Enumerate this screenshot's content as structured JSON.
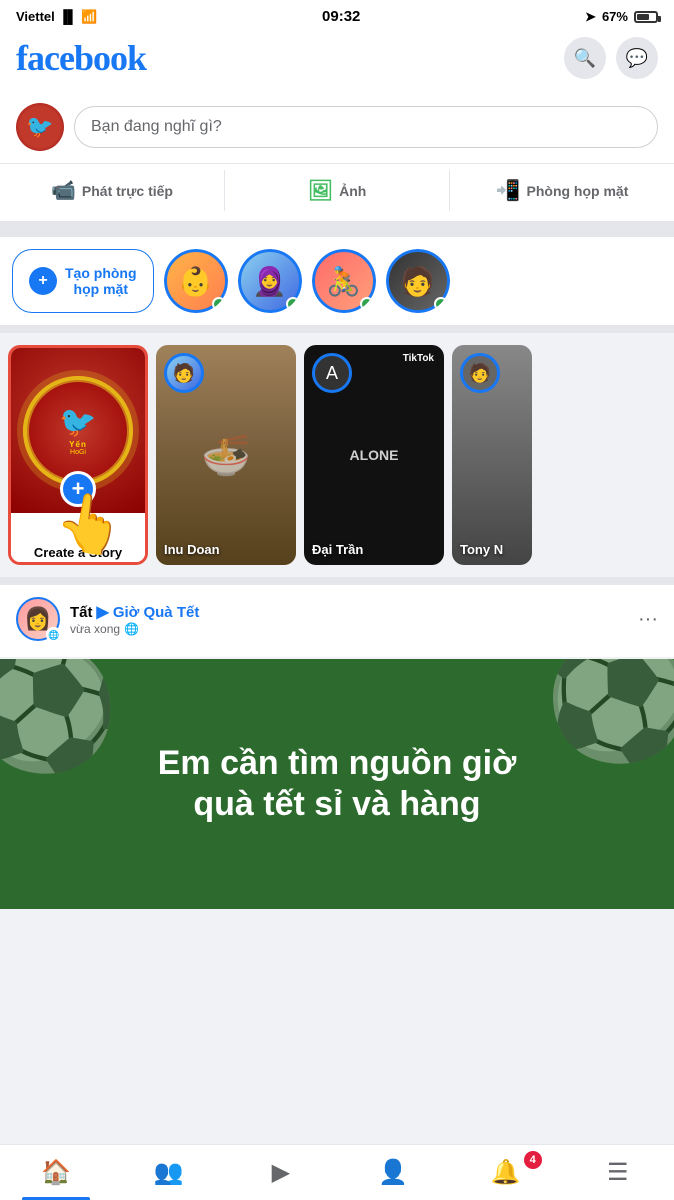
{
  "statusBar": {
    "carrier": "Viettel",
    "time": "09:32",
    "battery": "67%"
  },
  "header": {
    "logo": "facebook",
    "searchIcon": "🔍",
    "messengerIcon": "💬"
  },
  "postBar": {
    "placeholder": "Bạn đang nghĩ gì?"
  },
  "actionButtons": [
    {
      "id": "live",
      "label": "Phát trực tiếp",
      "icon": "📹"
    },
    {
      "id": "photo",
      "label": "Ảnh",
      "icon": "🖼"
    },
    {
      "id": "room",
      "label": "Phòng họp mặt",
      "icon": "📲"
    }
  ],
  "stories": {
    "createRoomLabel": "Tạo phòng họp mặt",
    "cards": [
      {
        "id": "create",
        "label": "Create a Story",
        "type": "create"
      },
      {
        "id": "inu",
        "label": "Inu Doan",
        "type": "other"
      },
      {
        "id": "dai",
        "label": "Đại Trần",
        "type": "other"
      },
      {
        "id": "tony",
        "label": "Tony N",
        "type": "other"
      }
    ]
  },
  "post": {
    "author": "Tất",
    "arrow": "▶",
    "destination": "Giờ Quà Tết",
    "meta": "🌐"
  },
  "banner": {
    "text": "Em cần tìm nguồn giờ quà tết sỉ và hàng"
  },
  "bottomNav": [
    {
      "id": "home",
      "icon": "🏠",
      "active": true
    },
    {
      "id": "friends",
      "icon": "👥",
      "active": false
    },
    {
      "id": "watch",
      "icon": "▶",
      "active": false
    },
    {
      "id": "profile",
      "icon": "👤",
      "active": false
    },
    {
      "id": "notifications",
      "icon": "🔔",
      "active": false,
      "badge": "4"
    },
    {
      "id": "menu",
      "icon": "☰",
      "active": false
    }
  ]
}
